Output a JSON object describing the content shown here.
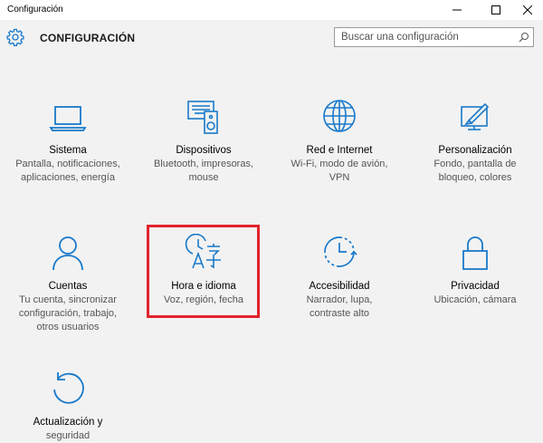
{
  "window": {
    "title": "Configuración",
    "minimize_icon": "minimize-icon",
    "maximize_icon": "maximize-icon",
    "close_icon": "close-icon"
  },
  "header": {
    "title": "CONFIGURACIÓN",
    "search_placeholder": "Buscar una configuración",
    "icon": "gear-icon"
  },
  "accent_color": "#1979ca",
  "highlight_color": "#e0232b",
  "tiles": [
    {
      "name": "Sistema",
      "desc": "Pantalla, notificaciones,\naplicaciones, energía",
      "icon": "laptop-icon"
    },
    {
      "name": "Dispositivos",
      "desc": "Bluetooth, impresoras,\nmouse",
      "icon": "devices-icon"
    },
    {
      "name": "Red e Internet",
      "desc": "Wi-Fi, modo de avión,\nVPN",
      "icon": "globe-icon"
    },
    {
      "name": "Personalización",
      "desc": "Fondo, pantalla de\nbloqueo, colores",
      "icon": "personalization-icon"
    },
    {
      "name": "Cuentas",
      "desc": "Tu cuenta, sincronizar\nconfiguración, trabajo,\notros usuarios",
      "icon": "person-icon"
    },
    {
      "name": "Hora e idioma",
      "desc": "Voz, región, fecha",
      "icon": "time-language-icon",
      "highlighted": true
    },
    {
      "name": "Accesibilidad",
      "desc": "Narrador, lupa,\ncontraste alto",
      "icon": "ease-of-access-icon"
    },
    {
      "name": "Privacidad",
      "desc": "Ubicación, cámara",
      "icon": "lock-icon"
    },
    {
      "name": "Actualización y",
      "desc": "seguridad",
      "icon": "update-icon"
    }
  ]
}
